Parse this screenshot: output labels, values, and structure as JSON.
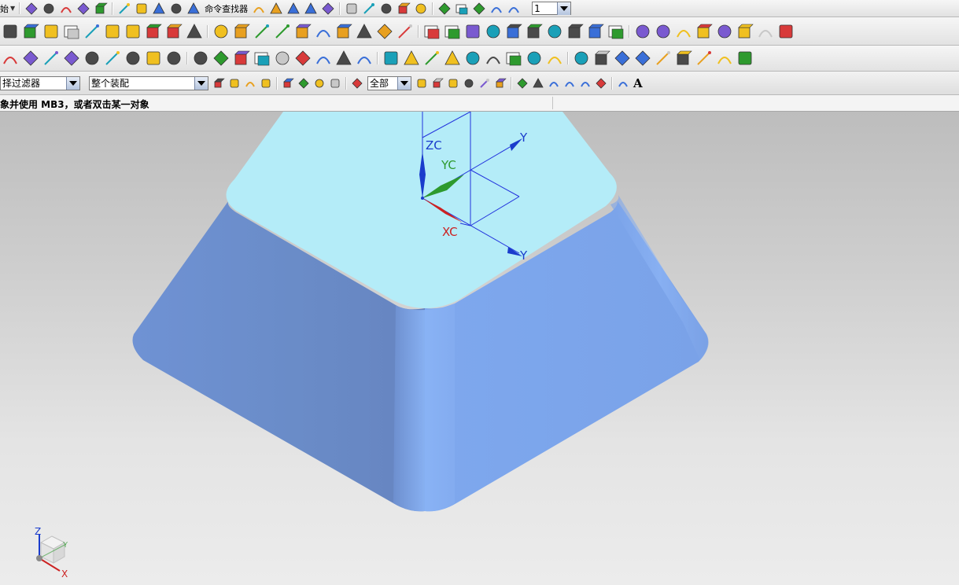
{
  "toolbar1": {
    "start_menu_label": "始",
    "command_finder_label": "命令查找器",
    "layer_value": "1",
    "icons": [
      "new-file-icon",
      "open-folder-icon",
      "save-icon",
      "print-icon",
      "cut-icon",
      "copy-icon",
      "paste-icon",
      "delete-icon",
      "undo-icon",
      "redo-icon",
      "command-finder-icon",
      "snap-icon",
      "edit-object-icon",
      "properties-icon",
      "info-icon",
      "part-navigator-icon",
      "wcs-icon",
      "layer-icon",
      "shading-icon",
      "view-orient-icon",
      "render-icon",
      "display-icon",
      "move-icon",
      "transform-icon",
      "analysis-icon"
    ]
  },
  "toolbar2": {
    "icons": [
      "arc-icon",
      "circle-icon",
      "rectangle-icon",
      "polygon-icon",
      "helix-icon",
      "spline-icon",
      "curve-icon",
      "polyline-icon",
      "profile-icon",
      "offset-curve-icon",
      "trim-curve-icon",
      "bridge-curve-icon",
      "project-curve-icon",
      "fillet-curve-icon",
      "intersect-icon",
      "extract-icon",
      "section-icon",
      "mesh-icon",
      "extrude-sketch-icon",
      "revolve-sketch-icon",
      "surface-through-curves-icon",
      "bounded-plane-icon",
      "ruled-surface-icon",
      "sweep-surface-icon",
      "n-sided-icon",
      "offset-surface-icon",
      "trim-sheet-icon",
      "extend-sheet-icon",
      "sew-icon",
      "patch-icon",
      "studio-surface-icon",
      "law-extension-icon",
      "flange-icon",
      "bridge-surface-icon",
      "silhouette-icon",
      "styled-blend-icon",
      "transition-icon",
      "global-shaping-icon"
    ]
  },
  "toolbar3": {
    "icons": [
      "sketch-icon",
      "extrude-icon",
      "revolve-icon",
      "block-icon",
      "cylinder-icon",
      "cone-icon",
      "sphere-icon",
      "boss-icon",
      "hole-icon",
      "pad-icon",
      "pocket-icon",
      "slot-icon",
      "groove-icon",
      "feature-pattern-icon",
      "edge-blend-icon",
      "chamfer-icon",
      "shell-icon",
      "draft-icon",
      "trim-body-icon",
      "split-body-icon",
      "unite-icon",
      "subtract-icon",
      "intersect-body-icon",
      "thicken-icon",
      "scale-body-icon",
      "offset-face-icon",
      "replace-face-icon",
      "move-face-icon",
      "delete-face-icon",
      "datum-plane-icon",
      "datum-axis-icon",
      "datum-csys-icon",
      "measure-icon",
      "assembly-icon",
      "mold-icon",
      "drafting-icon"
    ]
  },
  "toolbar4": {
    "type_filter_value": "择过滤器",
    "assembly_filter_value": "整个装配",
    "scope_value": "全部",
    "label_a": "A",
    "icons": [
      "filter-settings-icon",
      "select-all-icon",
      "color-filter-icon",
      "deselect-icon",
      "select-face-icon",
      "select-body-icon",
      "select-feature-icon",
      "select-curve-icon",
      "rectangle-select-icon",
      "snap-points-icon",
      "existing-point-icon",
      "end-point-icon",
      "mid-point-icon",
      "control-point-icon",
      "intersection-point-icon",
      "arc-center-icon",
      "quadrant-point-icon",
      "point-on-curve-icon",
      "point-on-face-icon",
      "bounded-grid-icon",
      "snap-to-point-icon",
      "wcs-origin-icon"
    ]
  },
  "status": {
    "prompt": "象并使用 MB3，或者双击某一对象"
  },
  "viewport": {
    "wcs_labels": {
      "z": "ZC",
      "y": "YC",
      "x": "XC"
    },
    "datum_labels": {
      "top": "Y",
      "bottom": "Y"
    },
    "triad_labels": {
      "z": "Z",
      "x": "X",
      "y": "Y"
    },
    "colors": {
      "background_top": "#bdbdbd",
      "background_bottom": "#ececec",
      "top_face": "#b4ecf8",
      "side_face_light": "#8ab0f2",
      "side_face_mid": "#7aa4ec",
      "side_face_dark": "#6a8ac8",
      "x_axis": "#cc2222",
      "y_axis": "#2e9a2e",
      "z_axis": "#1a3ccc",
      "datum_lines": "#2233dd"
    }
  }
}
